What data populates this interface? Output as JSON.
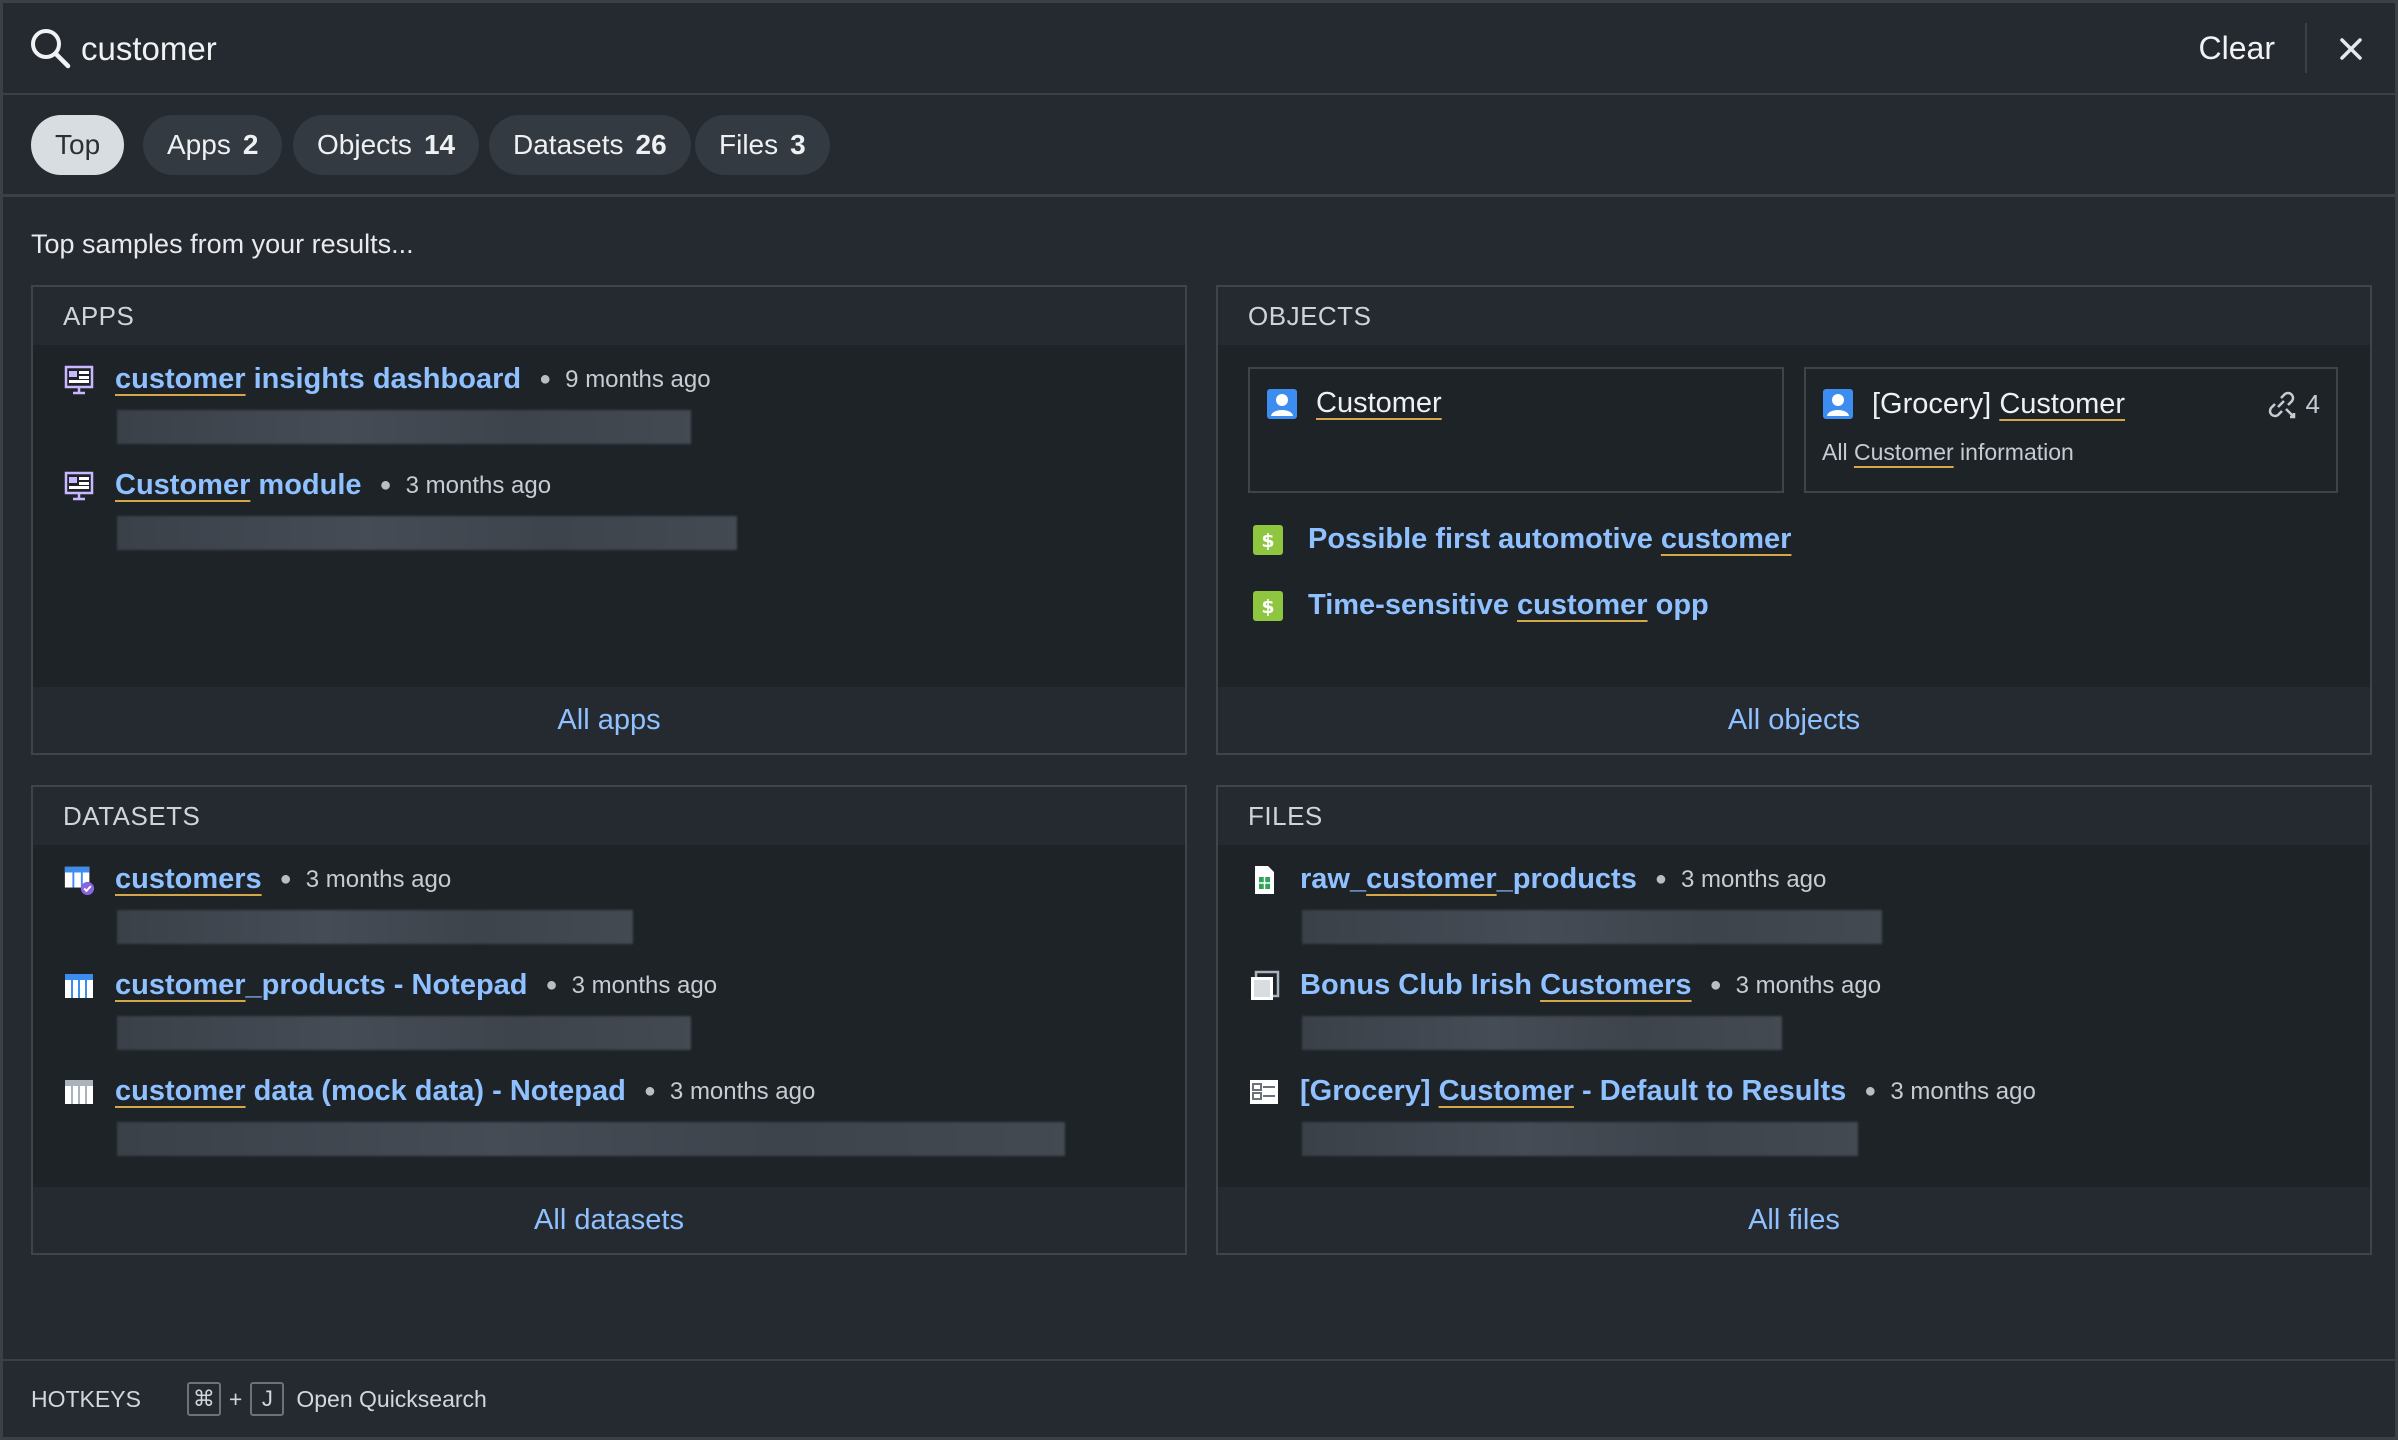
{
  "search": {
    "query": "customer",
    "clear_label": "Clear"
  },
  "tabs": [
    {
      "label": "Top",
      "count": ""
    },
    {
      "label": "Apps",
      "count": "2"
    },
    {
      "label": "Objects",
      "count": "14"
    },
    {
      "label": "Datasets",
      "count": "26"
    },
    {
      "label": "Files",
      "count": "3"
    }
  ],
  "intro": "Top samples from your results...",
  "apps": {
    "header": "APPS",
    "items": [
      {
        "hl": "customer",
        "rest": " insights dashboard",
        "time": "9 months ago"
      },
      {
        "hl": "Customer",
        "rest": " module",
        "time": "3 months ago"
      }
    ],
    "footer": "All apps"
  },
  "objects": {
    "header": "OBJECTS",
    "card1": {
      "title": "Customer"
    },
    "card2": {
      "prefix": "[Grocery] ",
      "title": "Customer",
      "link_count": "4",
      "sub_pre": "All ",
      "sub_hl": "Customer",
      "sub_post": " information"
    },
    "items": [
      {
        "pre": "Possible first automotive ",
        "hl": "customer",
        "post": ""
      },
      {
        "pre": "Time-sensitive ",
        "hl": "customer",
        "post": " opp"
      }
    ],
    "footer": "All objects"
  },
  "datasets": {
    "header": "DATASETS",
    "items": [
      {
        "pre": "",
        "hl": "customers",
        "post": "",
        "time": "3 months ago"
      },
      {
        "pre": "",
        "hl": "customer",
        "post": "_products - Notepad",
        "time": "3 months ago"
      },
      {
        "pre": "",
        "hl": "customer",
        "post": " data (mock data) - Notepad",
        "time": "3 months ago"
      }
    ],
    "footer": "All datasets"
  },
  "files": {
    "header": "FILES",
    "items": [
      {
        "pre": "raw_",
        "hl": "customer",
        "post": "_products",
        "time": "3 months ago"
      },
      {
        "pre": "Bonus Club Irish ",
        "hl": "Customers",
        "post": "",
        "time": "3 months ago"
      },
      {
        "pre": "[Grocery] ",
        "hl": "Customer",
        "post": " - Default to Results",
        "time": "3 months ago"
      }
    ],
    "footer": "All files"
  },
  "hotkeys": {
    "label": "HOTKEYS",
    "key1": "⌘",
    "plus": "+",
    "key2": "J",
    "action": "Open Quicksearch"
  },
  "colors": {
    "accent_link": "#8fc0ff",
    "highlight_underline": "#d4a84a",
    "background": "#252a31"
  }
}
